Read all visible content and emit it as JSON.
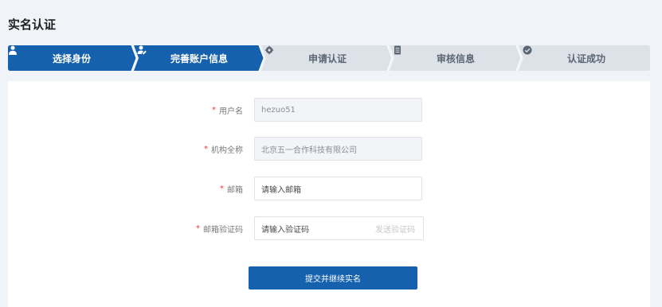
{
  "page": {
    "title": "实名认证"
  },
  "steps": [
    {
      "label": "选择身份",
      "icon": "user-icon",
      "state": "active"
    },
    {
      "label": "完善账户信息",
      "icon": "user-edit-icon",
      "state": "active"
    },
    {
      "label": "申请认证",
      "icon": "gear-icon",
      "state": "inactive"
    },
    {
      "label": "审核信息",
      "icon": "document-icon",
      "state": "inactive"
    },
    {
      "label": "认证成功",
      "icon": "check-circle-icon",
      "state": "inactive"
    }
  ],
  "colors": {
    "active": "#1561ad",
    "inactive": "#dde2e8",
    "required": "#e03b3b"
  },
  "form": {
    "username": {
      "label": "用户名",
      "value": "hezuo51"
    },
    "org_name": {
      "label": "机构全称",
      "value": "北京五一合作科技有限公司"
    },
    "email": {
      "label": "邮箱",
      "placeholder": "请输入邮箱"
    },
    "email_code": {
      "label": "邮箱验证码",
      "placeholder": "请输入验证码",
      "send_label": "发送验证码"
    },
    "required_mark": "*",
    "submit_label": "提交并继续实名"
  }
}
